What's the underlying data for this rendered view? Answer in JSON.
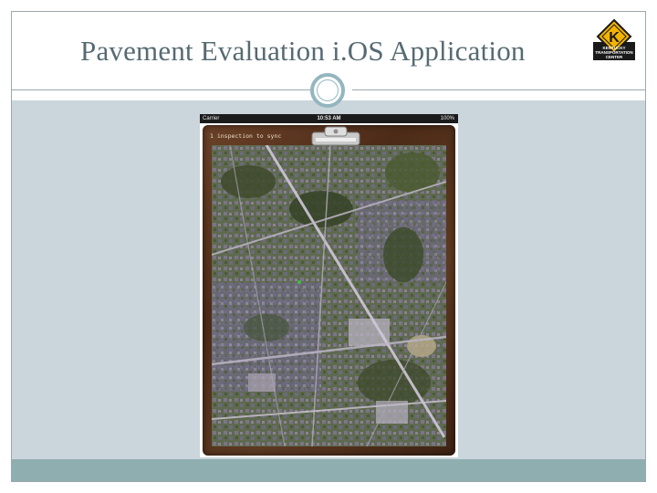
{
  "slide": {
    "title": "Pavement Evaluation i.OS Application",
    "logo": {
      "icon": "kentucky-transportation-logo-icon",
      "letter": "K",
      "text_lines": [
        "KENTUCKY",
        "TRANSPORTATION",
        "CENTER"
      ]
    }
  },
  "device": {
    "status_bar": {
      "carrier": "Carrier",
      "time": "10:53 AM",
      "battery": "100%"
    },
    "sync_label": "1 inspection to sync",
    "map_icon": "satellite-map-icon",
    "clip_icon": "clipboard-clip-icon"
  },
  "colors": {
    "title": "#566a72",
    "content_panel": "#cbd6dc",
    "footer_bar": "#8faeb0",
    "ring": "#93b6bf",
    "wood": "#5e3a22"
  }
}
